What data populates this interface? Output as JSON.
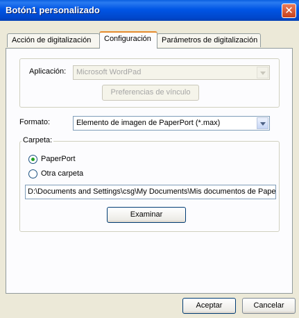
{
  "window": {
    "title": "Botón1 personalizado",
    "close_glyph": "✕"
  },
  "tabs": [
    {
      "label": "Acción de digitalización"
    },
    {
      "label": "Configuración"
    },
    {
      "label": "Parámetros de digitalización"
    }
  ],
  "app_group": {
    "app_label": "Aplicación:",
    "app_value": "Microsoft WordPad",
    "link_prefs_button": "Preferencias de vínculo"
  },
  "format": {
    "label": "Formato:",
    "value": "Elemento de imagen de PaperPort (*.max)"
  },
  "folder": {
    "group_label": "Carpeta:",
    "option_paperport": "PaperPort",
    "option_other": "Otra carpeta",
    "path": "D:\\Documents and Settings\\csg\\My Documents\\Mis documentos de PaperPort",
    "browse_button": "Examinar"
  },
  "footer": {
    "accept": "Aceptar",
    "cancel": "Cancelar"
  }
}
